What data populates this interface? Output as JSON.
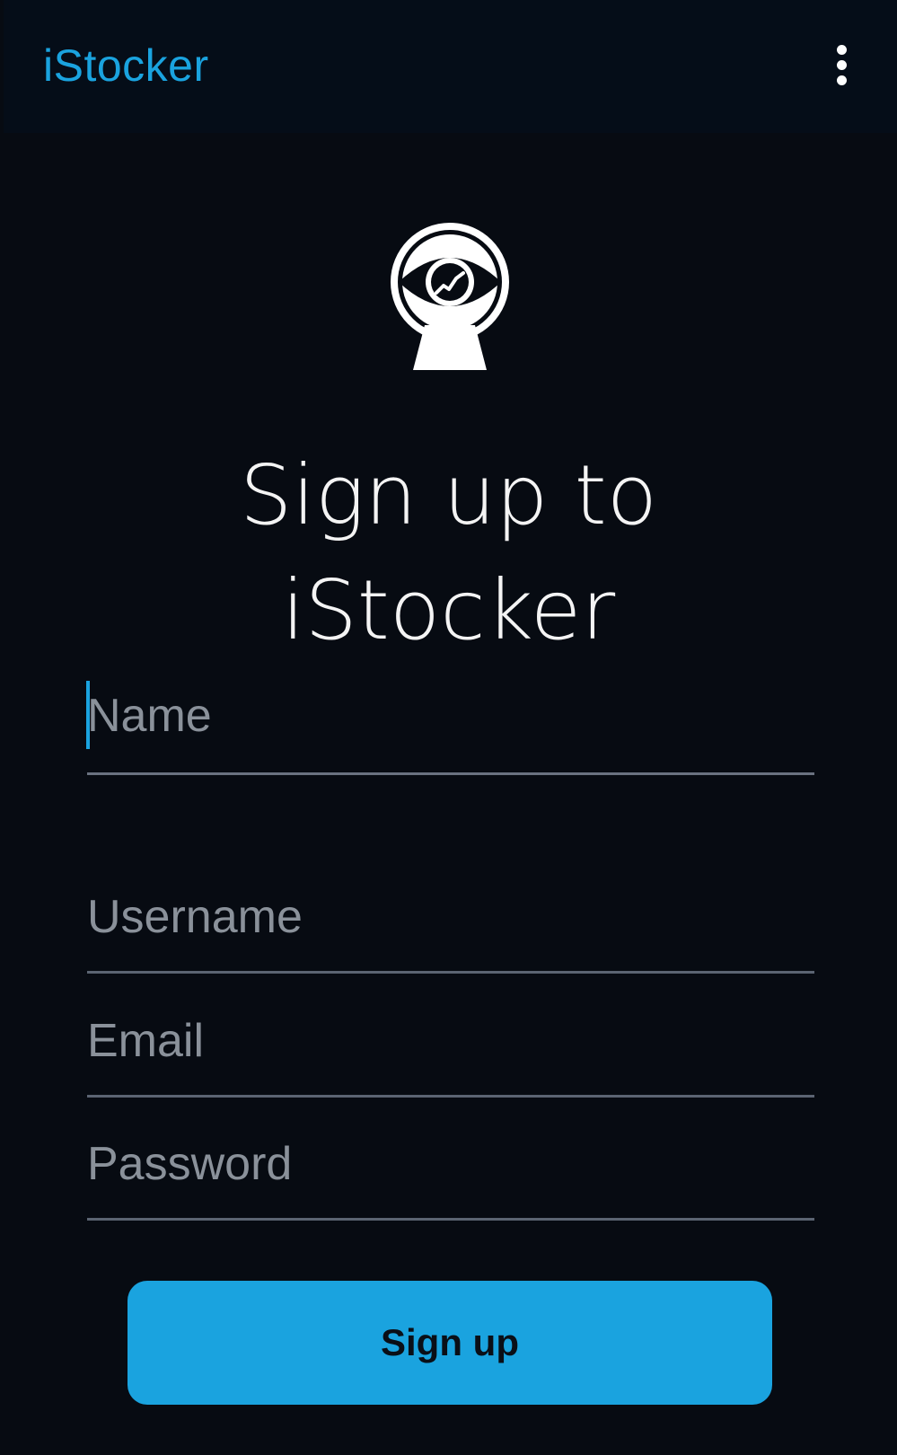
{
  "app_bar": {
    "title": "iStocker",
    "menu_icon": "more-vertical-icon"
  },
  "logo": {
    "icon": "eye-stock-chart-logo"
  },
  "heading": {
    "line1": "Sign up to",
    "line2": "iStocker"
  },
  "form": {
    "name": {
      "placeholder": "Name",
      "value": ""
    },
    "username": {
      "placeholder": "Username",
      "value": ""
    },
    "email": {
      "placeholder": "Email",
      "value": ""
    },
    "password": {
      "placeholder": "Password",
      "value": ""
    }
  },
  "signup_button": {
    "label": "Sign up"
  },
  "colors": {
    "background": "#070b12",
    "app_bar": "#050d18",
    "accent": "#1aa3df",
    "text": "#f4f4f4",
    "placeholder": "#8a919a",
    "underline": "#5b6472"
  }
}
